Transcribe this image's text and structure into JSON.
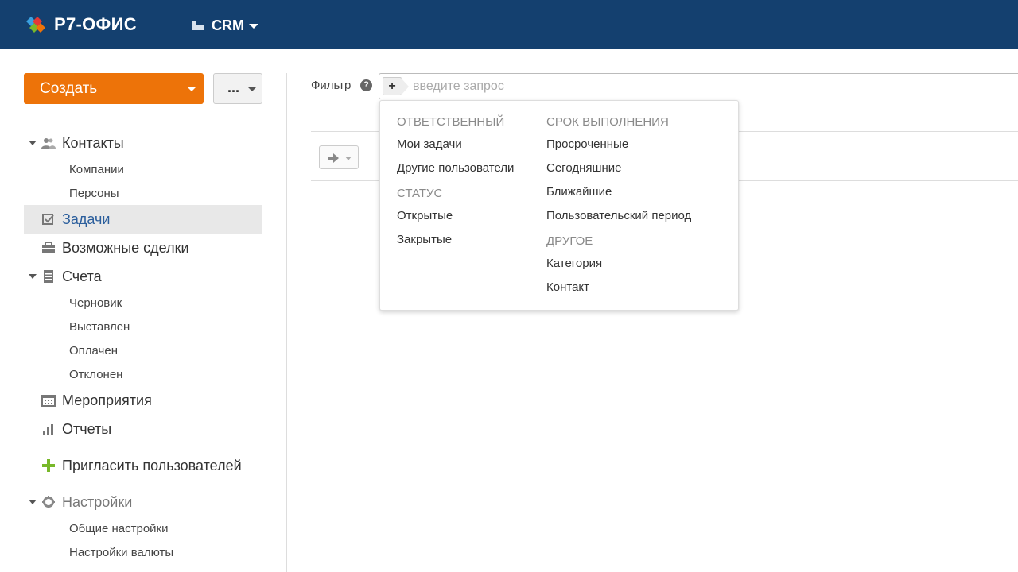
{
  "header": {
    "logo_text": "Р7-ОФИС",
    "module_label": "CRM",
    "colors": {
      "bar": "#14406f",
      "logo_orange": "#ed7309",
      "logo_blue": "#3aa0e0",
      "logo_green": "#78b82a",
      "logo_red": "#e53935"
    }
  },
  "sidebar": {
    "create_label": "Создать",
    "more_label": "...",
    "nav": {
      "contacts": {
        "label": "Контакты",
        "icon": "users-icon",
        "children": [
          "Компании",
          "Персоны"
        ]
      },
      "tasks": {
        "label": "Задачи",
        "icon": "checkbox-icon",
        "active": true
      },
      "deals": {
        "label": "Возможные сделки",
        "icon": "briefcase-icon"
      },
      "invoices": {
        "label": "Счета",
        "icon": "document-icon",
        "children": [
          "Черновик",
          "Выставлен",
          "Оплачен",
          "Отклонен"
        ]
      },
      "events": {
        "label": "Мероприятия",
        "icon": "calendar-icon"
      },
      "reports": {
        "label": "Отчеты",
        "icon": "bar-chart-icon"
      },
      "invite": {
        "label": "Пригласить пользователей",
        "icon": "plus-icon"
      },
      "settings": {
        "label": "Настройки",
        "icon": "gear-icon",
        "children": [
          "Общие настройки",
          "Настройки валюты"
        ]
      }
    }
  },
  "filter": {
    "label": "Фильтр",
    "help": "?",
    "add": "+",
    "placeholder": "введите запрос"
  },
  "dropdown": {
    "groups": {
      "responsible": {
        "title": "ОТВЕТСТВЕННЫЙ",
        "options": [
          "Мои задачи",
          "Другие пользователи"
        ]
      },
      "status": {
        "title": "СТАТУС",
        "options": [
          "Открытые",
          "Закрытые"
        ]
      },
      "deadline": {
        "title": "СРОК ВЫПОЛНЕНИЯ",
        "options": [
          "Просроченные",
          "Сегодняшние",
          "Ближайшие",
          "Пользовательский период"
        ]
      },
      "other": {
        "title": "ДРУГОЕ",
        "options": [
          "Категория",
          "Контакт"
        ]
      }
    }
  }
}
